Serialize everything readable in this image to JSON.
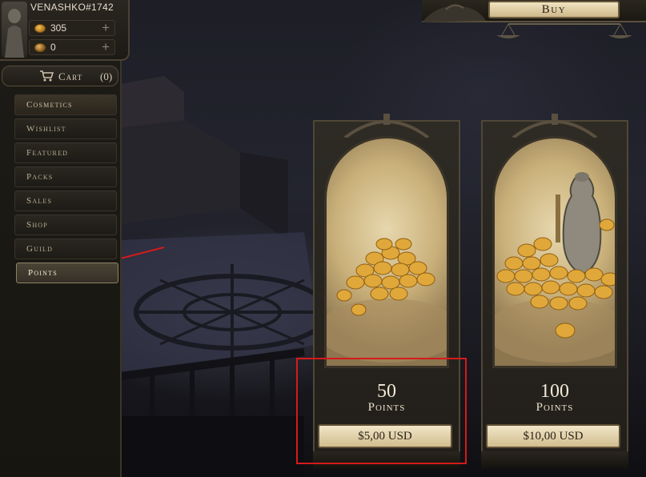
{
  "account": {
    "username": "VENASHKO#1742",
    "currencies": [
      {
        "icon": "gold-coin-icon",
        "value": "305"
      },
      {
        "icon": "silver-coin-icon",
        "value": "0"
      }
    ]
  },
  "cart": {
    "label": "Cart",
    "count": "(0)"
  },
  "nav": {
    "items": [
      {
        "label": "Cosmetics"
      },
      {
        "label": "Wishlist"
      },
      {
        "label": "Featured"
      },
      {
        "label": "Packs"
      },
      {
        "label": "Sales"
      },
      {
        "label": "Shop"
      },
      {
        "label": "Guild"
      },
      {
        "label": "Points"
      }
    ],
    "active": "Points"
  },
  "topbar": {
    "buy_label": "Buy"
  },
  "products": [
    {
      "amount": "50",
      "unit": "Points",
      "price": "$5,00 USD"
    },
    {
      "amount": "100",
      "unit": "Points",
      "price": "$10,00 USD"
    }
  ],
  "colors": {
    "annotation": "#d61a1a",
    "gold": "#e0a83a",
    "parchment": "#e7d7ad"
  }
}
